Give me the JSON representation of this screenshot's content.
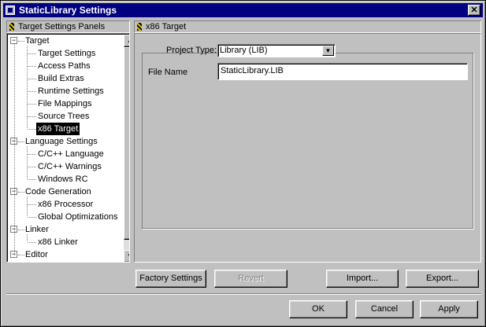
{
  "window": {
    "title": "StaticLibrary Settings",
    "close_label": "✕"
  },
  "left_panel": {
    "header": "Target Settings Panels"
  },
  "tree": {
    "groups": [
      {
        "label": "Target",
        "children": [
          "Target Settings",
          "Access Paths",
          "Build Extras",
          "Runtime Settings",
          "File Mappings",
          "Source Trees",
          "x86 Target"
        ]
      },
      {
        "label": "Language Settings",
        "children": [
          "C/C++ Language",
          "C/C++ Warnings",
          "Windows RC"
        ]
      },
      {
        "label": "Code Generation",
        "children": [
          "x86 Processor",
          "Global Optimizations"
        ]
      },
      {
        "label": "Linker",
        "children": [
          "x86 Linker"
        ]
      },
      {
        "label": "Editor",
        "children": []
      }
    ],
    "selected": "x86 Target",
    "expander_symbol": "−"
  },
  "right_panel": {
    "header": "x86 Target",
    "project_type_label": "Project Type:",
    "project_type_value": "Library (LIB)",
    "file_name_label": "File Name",
    "file_name_value": "StaticLibrary.LIB"
  },
  "buttons": {
    "factory_settings": "Factory Settings",
    "revert": "Revert",
    "import": "Import...",
    "export": "Export...",
    "ok": "OK",
    "cancel": "Cancel",
    "apply": "Apply"
  }
}
